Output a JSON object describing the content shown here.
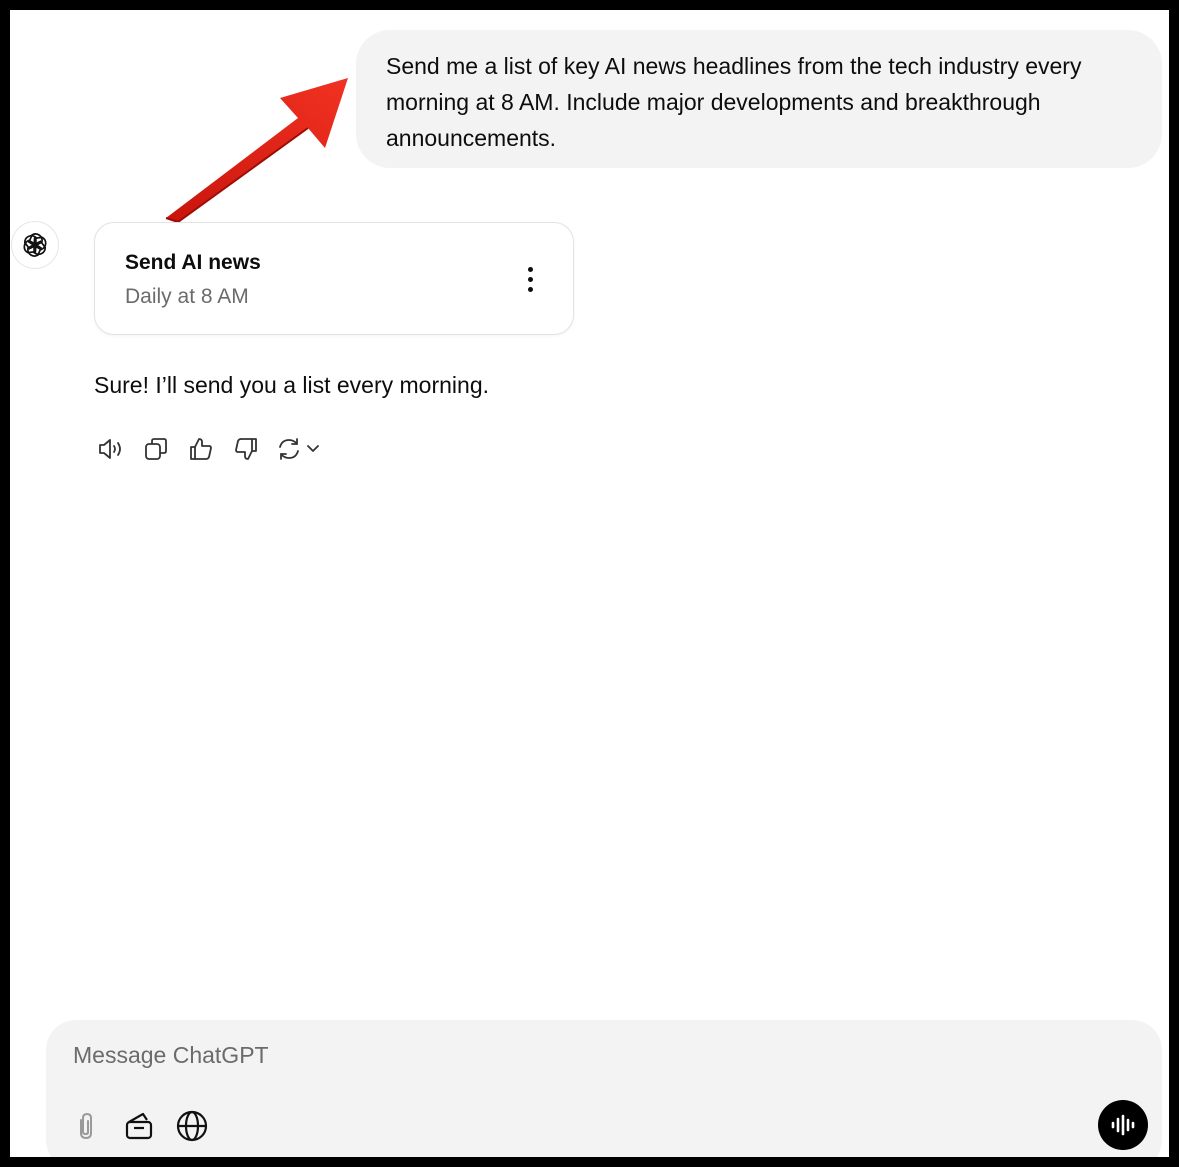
{
  "user_message": {
    "text": "Send me a list of key AI news headlines from the tech industry every morning at 8 AM. Include major developments and breakthrough announcements."
  },
  "assistant": {
    "avatar_icon": "openai-logo-icon",
    "task_card": {
      "title": "Send AI news",
      "schedule": "Daily at 8 AM",
      "menu_icon": "more-vertical-icon"
    },
    "reply_text": "Sure! I’ll send you a list every morning.",
    "actions": [
      "read-aloud-icon",
      "copy-icon",
      "thumbs-up-icon",
      "thumbs-down-icon",
      "regenerate-icon"
    ]
  },
  "annotation": {
    "arrow_color": "#e8251a"
  },
  "composer": {
    "placeholder": "Message ChatGPT",
    "tools": [
      "attach-icon",
      "tools-icon",
      "globe-icon"
    ],
    "voice_icon": "voice-mode-icon"
  },
  "colors": {
    "bubble_bg": "#f3f3f3",
    "text": "#0d0d0d",
    "muted": "#6b6b6b"
  }
}
